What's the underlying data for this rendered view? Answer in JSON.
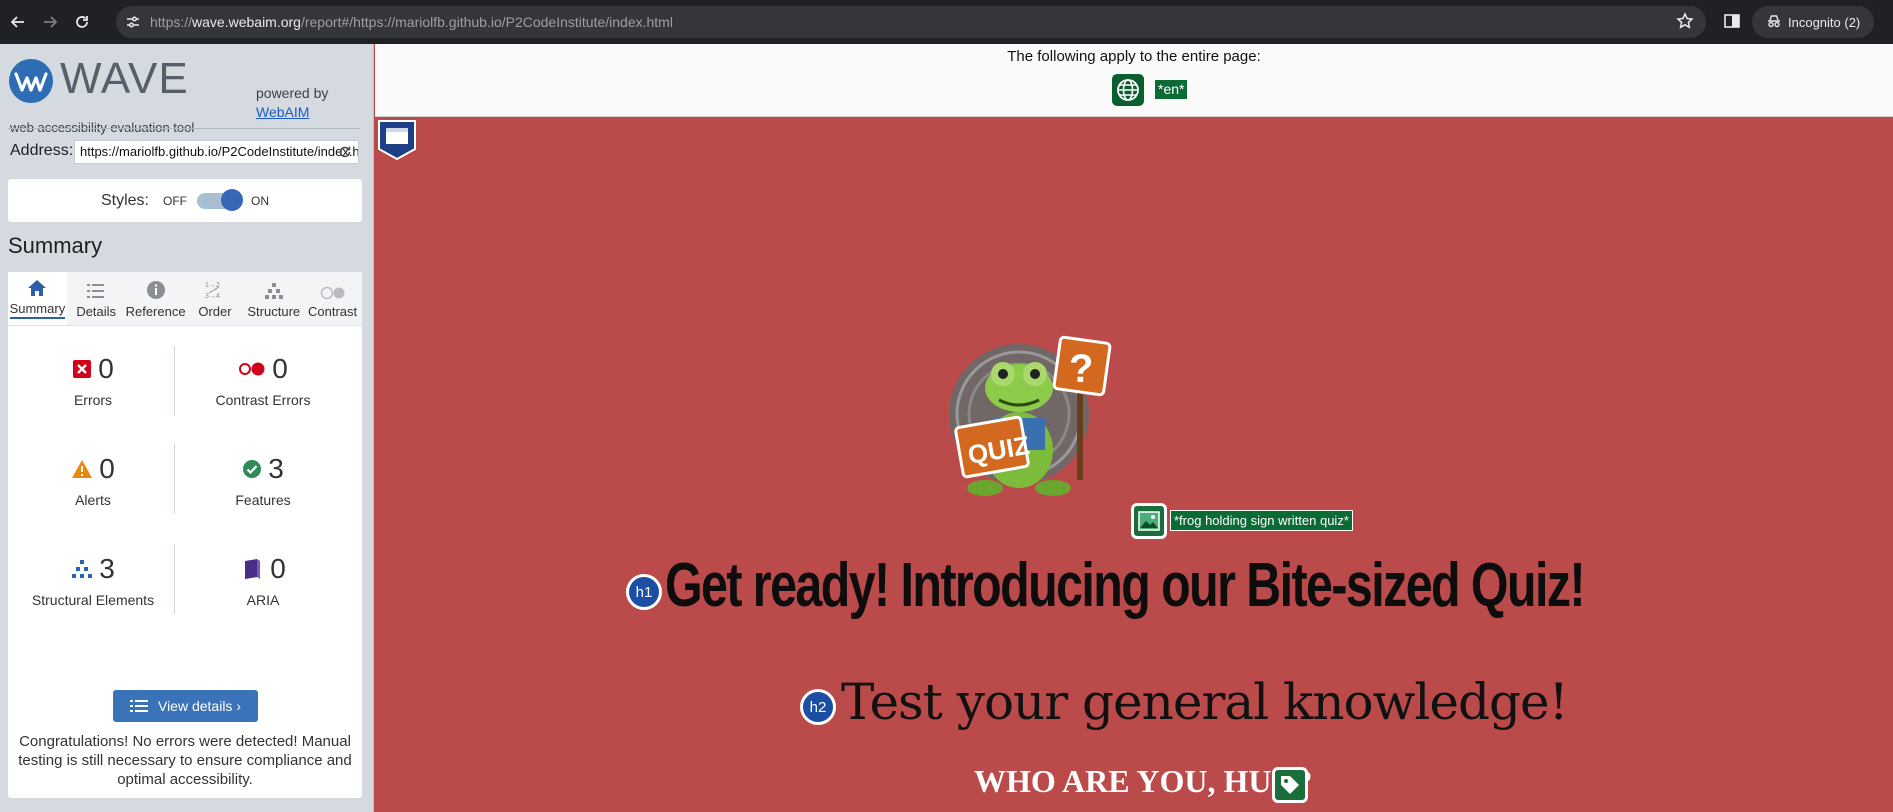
{
  "browser": {
    "url_prefix": "https://",
    "url_host": "wave.webaim.org",
    "url_path": "/report#/https://mariolfb.github.io/P2CodeInstitute/index.html",
    "incognito_label": "Incognito (2)"
  },
  "sidebar": {
    "logo_word": "WAVE",
    "tagline": "web accessibility evaluation tool",
    "powered_by": "powered by",
    "webaim_link": "WebAIM",
    "address_label": "Address:",
    "address_value": "https://mariolfb.github.io/P2CodeInstitute/index.html",
    "styles_label": "Styles:",
    "styles_off": "OFF",
    "styles_on": "ON",
    "summary_heading": "Summary",
    "tabs": [
      {
        "label": "Summary",
        "icon": "home-icon"
      },
      {
        "label": "Details",
        "icon": "list-icon"
      },
      {
        "label": "Reference",
        "icon": "info-icon"
      },
      {
        "label": "Order",
        "icon": "order-icon"
      },
      {
        "label": "Structure",
        "icon": "structure-icon"
      },
      {
        "label": "Contrast",
        "icon": "contrast-toggle-icon"
      }
    ],
    "stats": {
      "errors": {
        "value": "0",
        "label": "Errors"
      },
      "contrast_errors": {
        "value": "0",
        "label": "Contrast Errors"
      },
      "alerts": {
        "value": "0",
        "label": "Alerts"
      },
      "features": {
        "value": "3",
        "label": "Features"
      },
      "structural": {
        "value": "3",
        "label": "Structural Elements"
      },
      "aria": {
        "value": "0",
        "label": "ARIA"
      }
    },
    "view_details": "View details ›",
    "congrats": "Congratulations! No errors were detected! Manual testing is still necessary to ensure compliance and optimal accessibility."
  },
  "page": {
    "applies_text": "The following apply to the entire page:",
    "lang_tag": "*en*",
    "img_alt_tag": "*frog holding sign written quiz*",
    "h1_badge": "h1",
    "h1_text": "Get ready! Introducing our Bite-sized Quiz!",
    "h2_badge": "h2",
    "h2_text": "Test your general knowledge!",
    "who_text": "WHO ARE YOU, HUH?"
  },
  "colors": {
    "page_bg": "#bb4b4b",
    "wave_green": "#0b6b35",
    "wave_blue": "#1c4ea3",
    "button_blue": "#3b73b9"
  }
}
